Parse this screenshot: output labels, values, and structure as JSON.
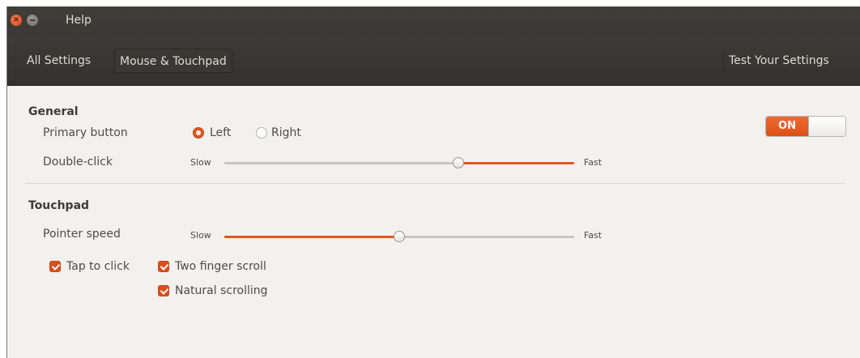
{
  "window": {
    "title": "Help",
    "close_glyph": "×"
  },
  "toolbar": {
    "all_settings": "All Settings",
    "breadcrumb": "Mouse & Touchpad",
    "test_settings": "Test Your Settings"
  },
  "general": {
    "title": "General",
    "primary_button_label": "Primary button",
    "primary_left": "Left",
    "primary_right": "Right",
    "primary_selected": "Left",
    "double_click_label": "Double-click",
    "double_click_slow": "Slow",
    "double_click_fast": "Fast",
    "double_click_level": 0.67
  },
  "touchpad": {
    "title": "Touchpad",
    "switch_label": "ON",
    "switch_on": true,
    "pointer_speed_label": "Pointer speed",
    "pointer_slow": "Slow",
    "pointer_fast": "Fast",
    "pointer_level": 0.5,
    "tap_to_click": "Tap to click",
    "two_finger_scroll": "Two finger scroll",
    "natural_scrolling": "Natural scrolling"
  },
  "colors": {
    "accent": "#e2571e",
    "titlebar": "#3c3b37",
    "background": "#f2f1f0"
  }
}
